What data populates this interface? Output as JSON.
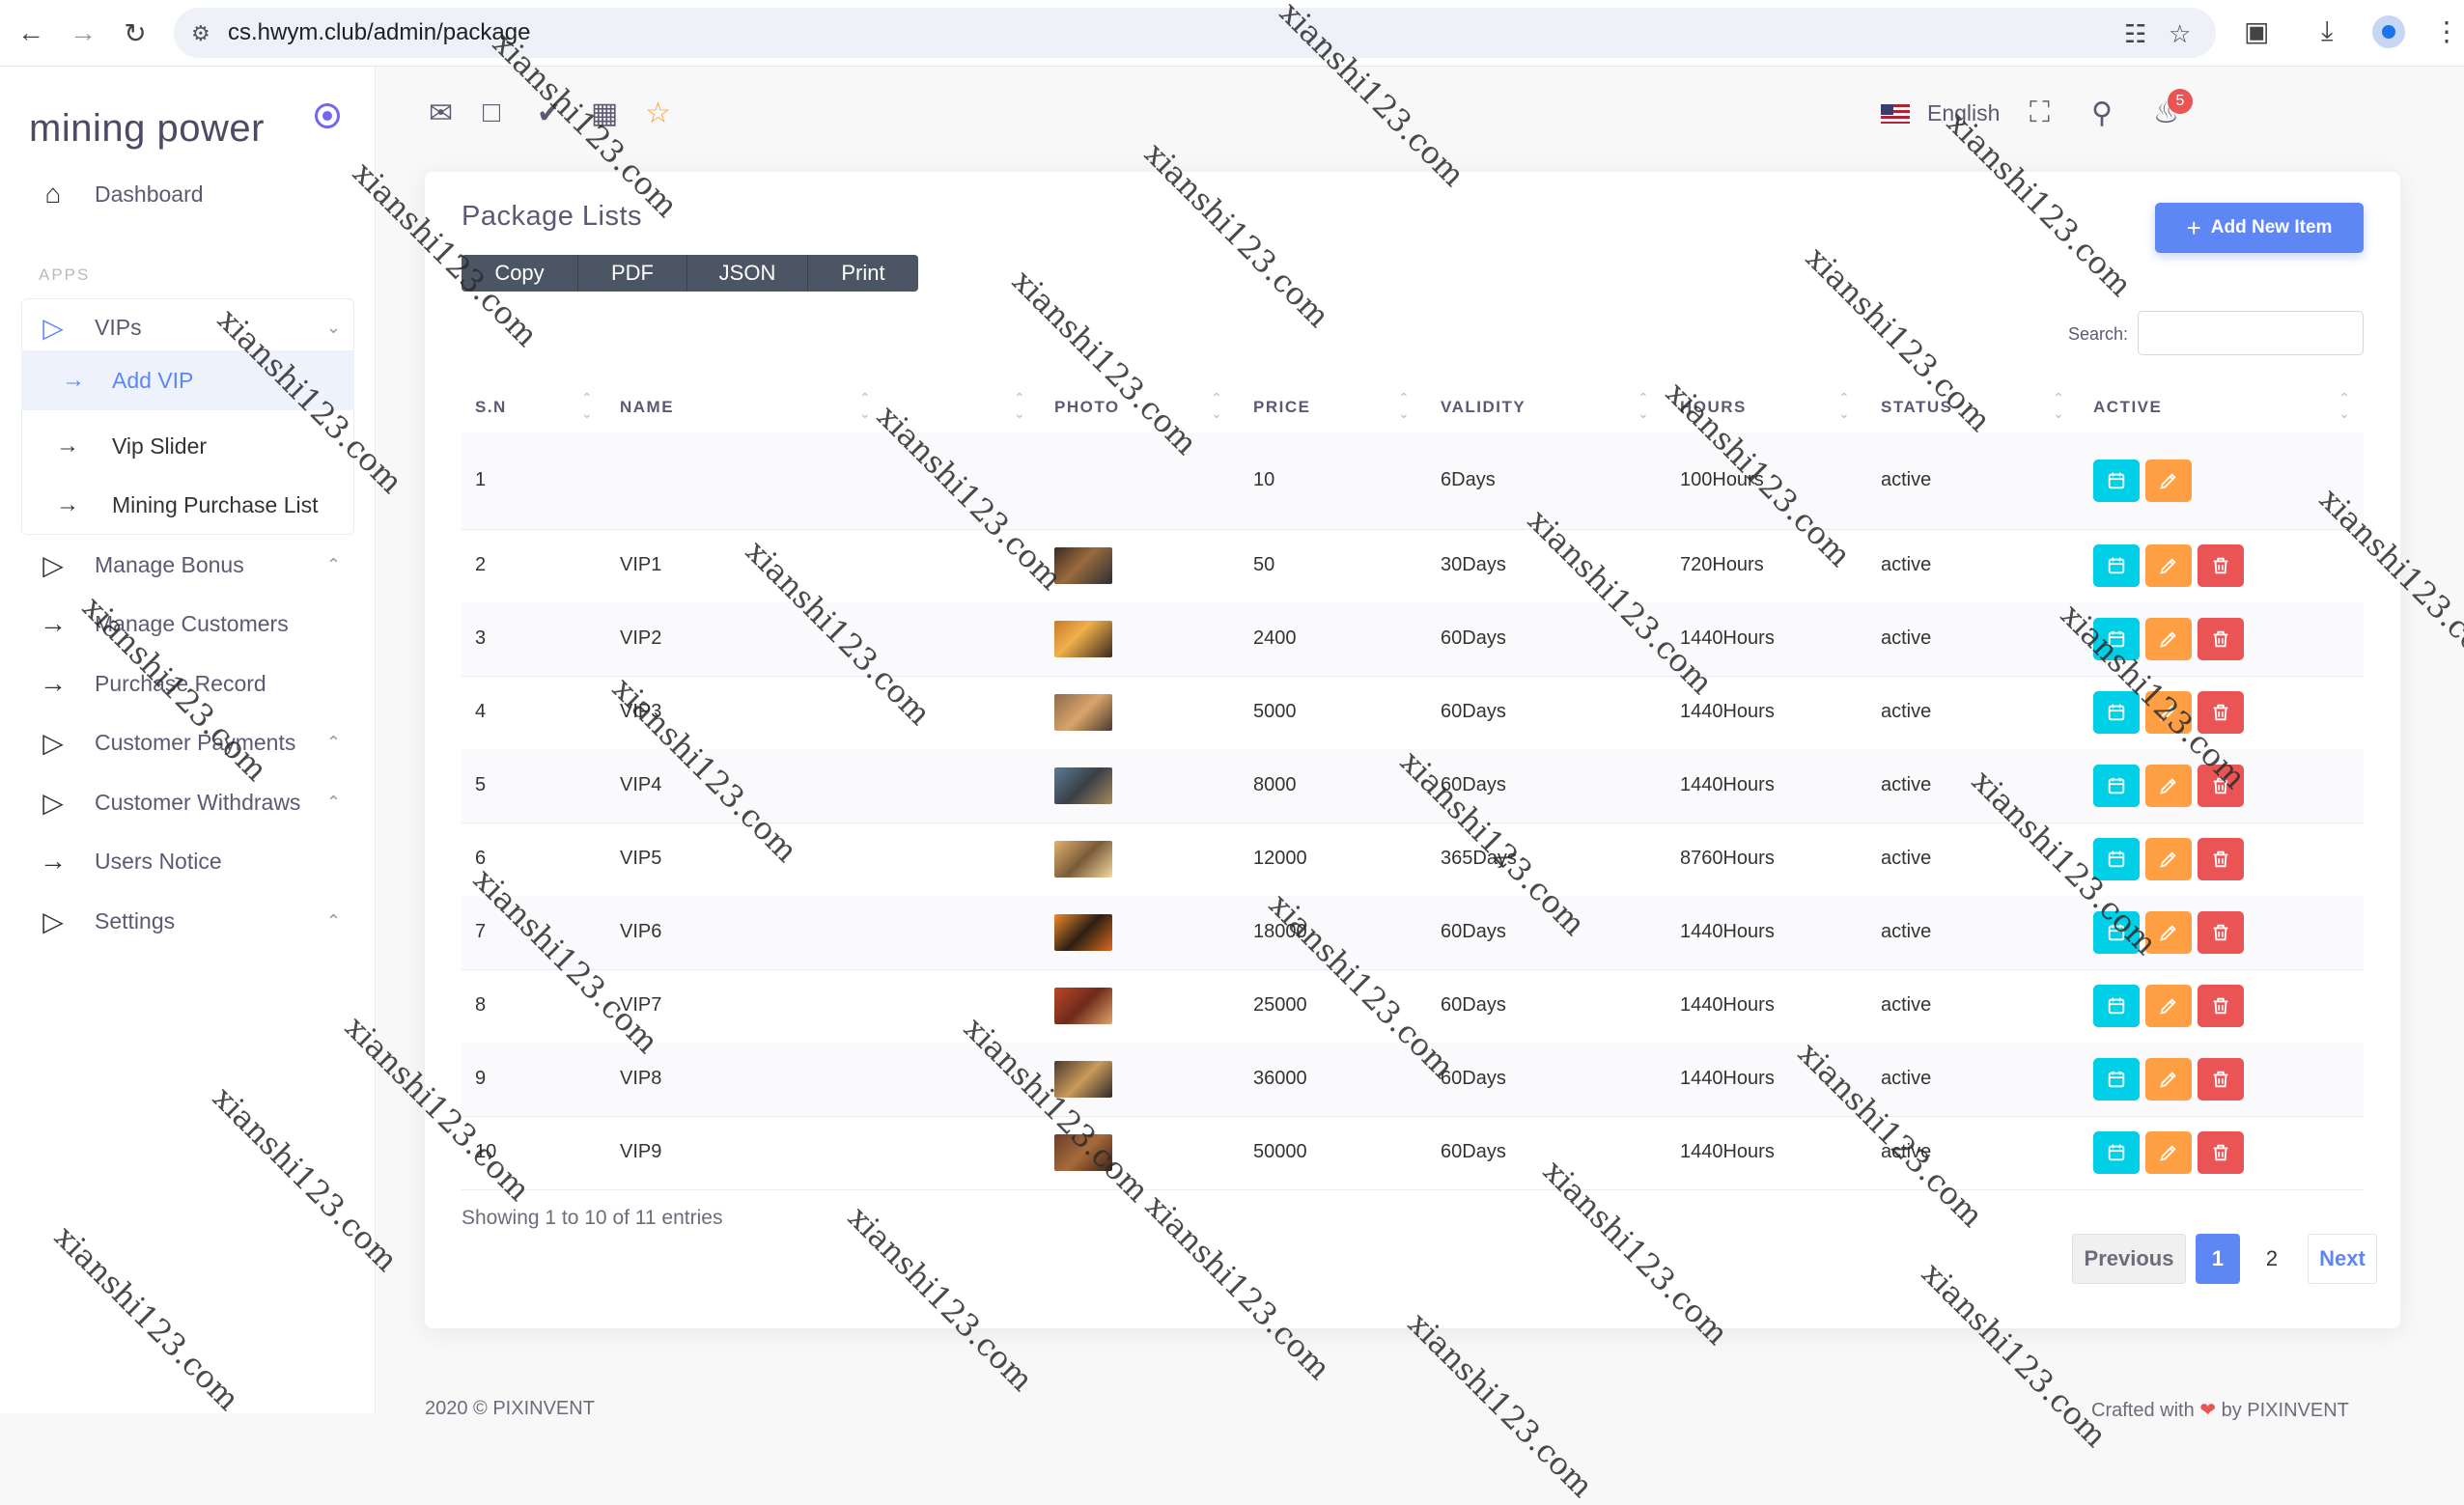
{
  "browser": {
    "url": "cs.hwym.club/admin/package",
    "icons": [
      "back-icon",
      "forward-icon",
      "reload-icon",
      "site-info-icon",
      "translate-icon",
      "bookmark-star-icon",
      "extensions-icon",
      "download-icon",
      "profile-avatar",
      "more-menu-icon"
    ]
  },
  "sidebar": {
    "brand": "mining power",
    "dashboard": "Dashboard",
    "apps_label": "APPS",
    "vips": "VIPs",
    "vip_sub": [
      "Add VIP",
      "Vip Slider",
      "Mining Purchase List"
    ],
    "manage_bonus": "Manage Bonus",
    "manage_customers": "Manage Customers",
    "purchase_record": "Purchase Record",
    "customer_payments": "Customer Payments",
    "customer_withdraws": "Customer Withdraws",
    "users_notice": "Users Notice",
    "settings": "Settings"
  },
  "topbar": {
    "language": "English",
    "notification_count": "5"
  },
  "card": {
    "title": "Package Lists",
    "export_buttons": [
      "Copy",
      "PDF",
      "JSON",
      "Print"
    ],
    "add_button": "Add New Item",
    "search_label": "Search:",
    "columns": [
      "S.N",
      "NAME",
      "PHOTO",
      "PRICE",
      "VALIDITY",
      "HOURS",
      "STATUS",
      "ACTIVE"
    ],
    "rows": [
      {
        "sn": "1",
        "name": "",
        "price": "10",
        "validity": "6Days",
        "hours": "100Hours",
        "status": "active"
      },
      {
        "sn": "2",
        "name": "VIP1",
        "price": "50",
        "validity": "30Days",
        "hours": "720Hours",
        "status": "active"
      },
      {
        "sn": "3",
        "name": "VIP2",
        "price": "2400",
        "validity": "60Days",
        "hours": "1440Hours",
        "status": "active"
      },
      {
        "sn": "4",
        "name": "VIP3",
        "price": "5000",
        "validity": "60Days",
        "hours": "1440Hours",
        "status": "active"
      },
      {
        "sn": "5",
        "name": "VIP4",
        "price": "8000",
        "validity": "60Days",
        "hours": "1440Hours",
        "status": "active"
      },
      {
        "sn": "6",
        "name": "VIP5",
        "price": "12000",
        "validity": "365Days",
        "hours": "8760Hours",
        "status": "active"
      },
      {
        "sn": "7",
        "name": "VIP6",
        "price": "18000",
        "validity": "60Days",
        "hours": "1440Hours",
        "status": "active"
      },
      {
        "sn": "8",
        "name": "VIP7",
        "price": "25000",
        "validity": "60Days",
        "hours": "1440Hours",
        "status": "active"
      },
      {
        "sn": "9",
        "name": "VIP8",
        "price": "36000",
        "validity": "60Days",
        "hours": "1440Hours",
        "status": "active"
      },
      {
        "sn": "10",
        "name": "VIP9",
        "price": "50000",
        "validity": "60Days",
        "hours": "1440Hours",
        "status": "active"
      }
    ],
    "showing": "Showing 1 to 10 of 11 entries",
    "pagination": {
      "prev": "Previous",
      "pages": [
        "1",
        "2"
      ],
      "next": "Next"
    }
  },
  "footer": {
    "left": "2020 © PIXINVENT",
    "right_prefix": "Crafted with",
    "right_suffix": "by PIXINVENT"
  },
  "watermark": "xianshi123.com",
  "colors": {
    "primary": "#5e86f5",
    "info": "#00cfe8",
    "warning": "#ff9f43",
    "danger": "#ea5455",
    "export_bar": "#4b5563"
  }
}
